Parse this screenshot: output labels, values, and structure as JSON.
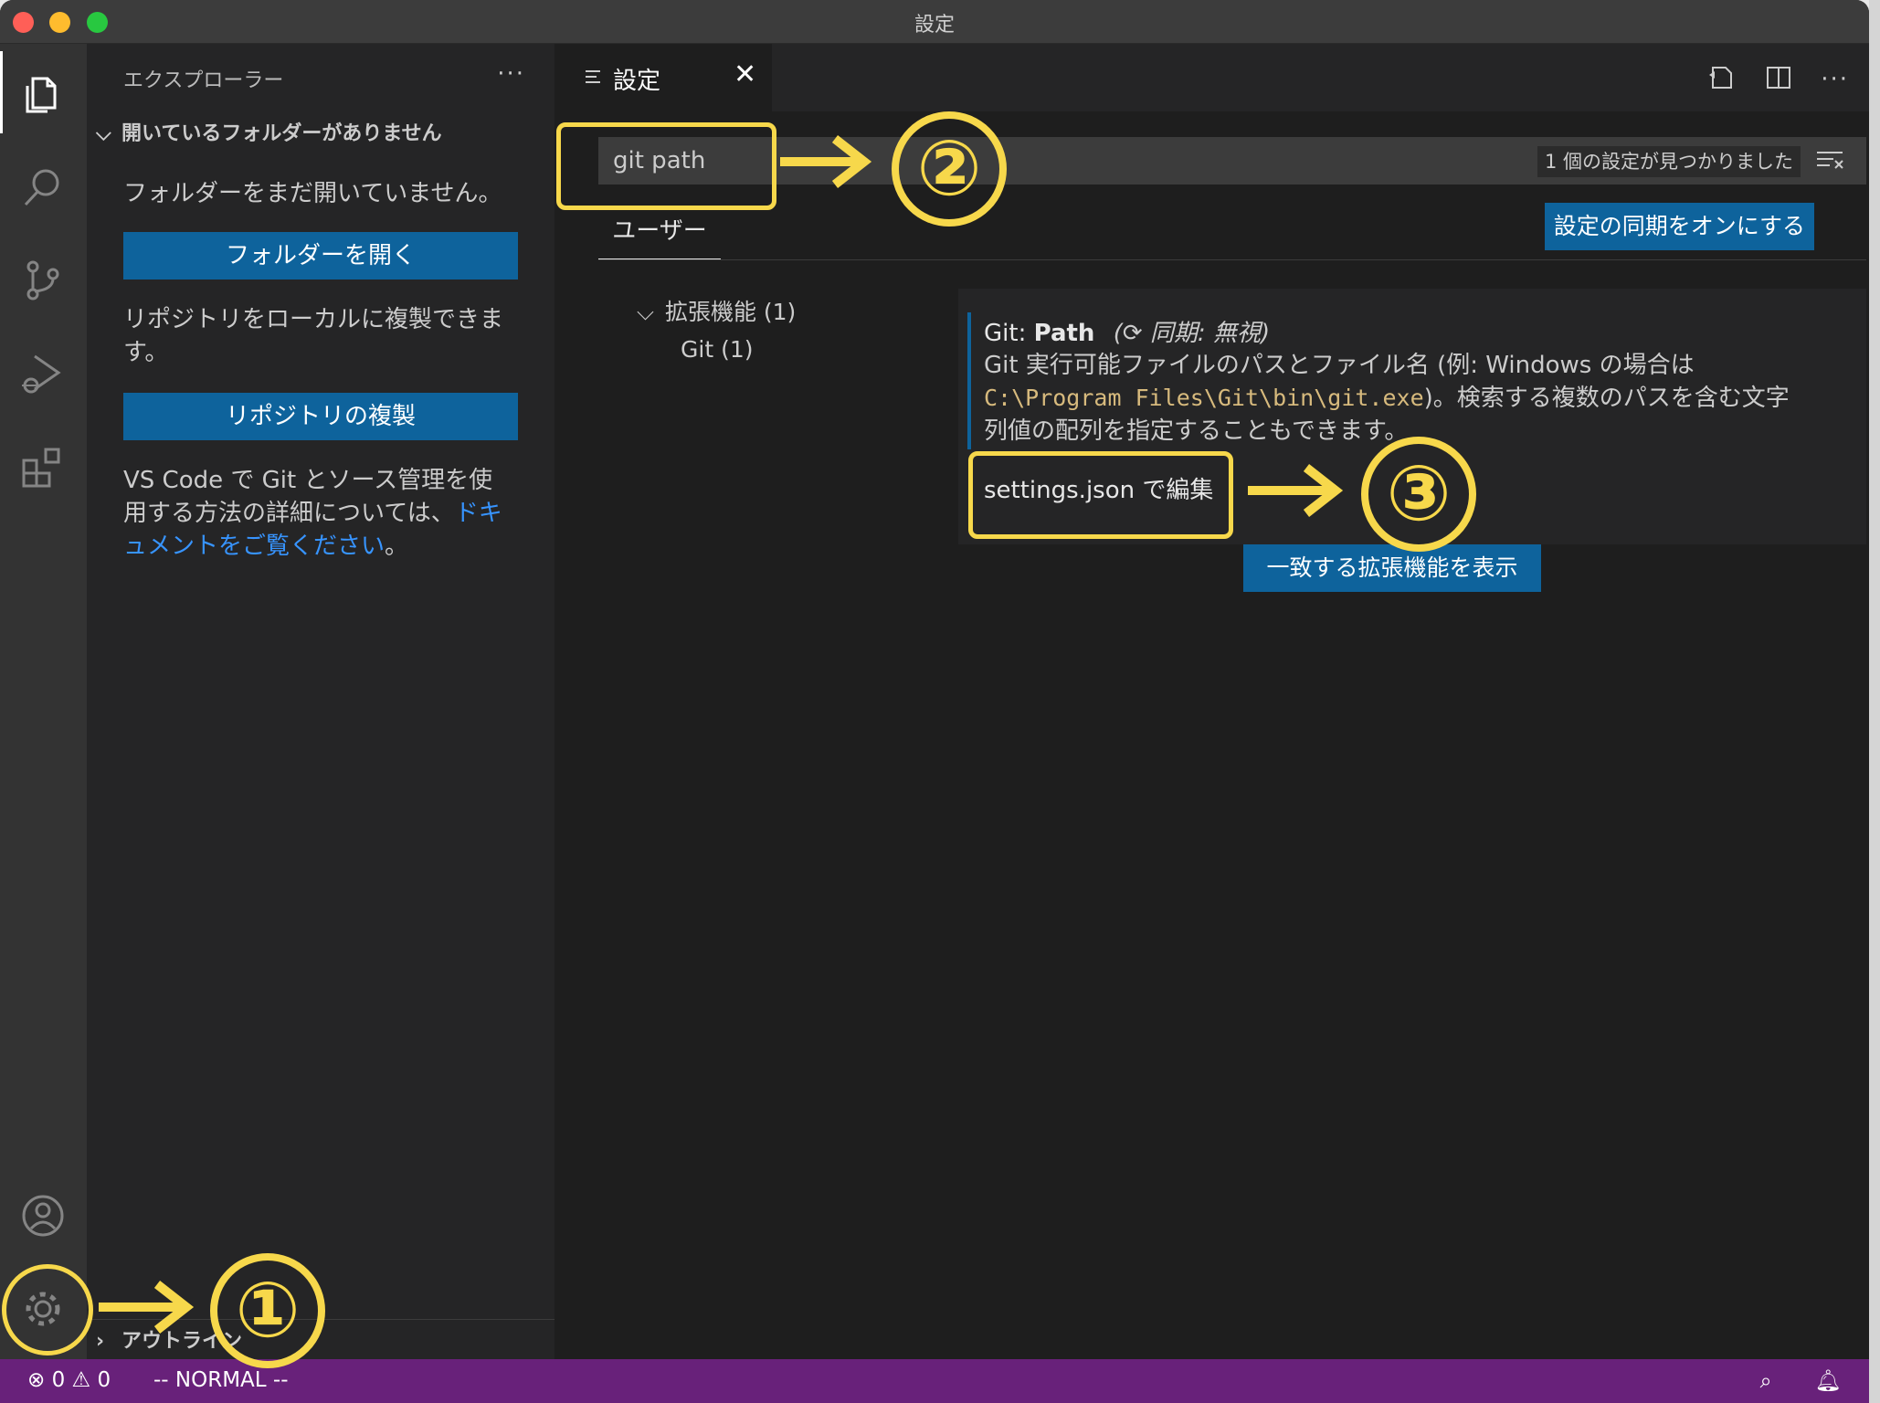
{
  "window": {
    "title": "設定",
    "traffic_lights": {
      "close": "#ff5f57",
      "minimize": "#febc2e",
      "maximize": "#28c840"
    }
  },
  "activity_bar": {
    "items": [
      {
        "icon": "files-icon"
      },
      {
        "icon": "search-icon"
      },
      {
        "icon": "source-control-icon"
      },
      {
        "icon": "run-debug-icon"
      },
      {
        "icon": "extensions-icon"
      }
    ],
    "bottom": [
      {
        "icon": "account-icon"
      },
      {
        "icon": "gear-icon"
      }
    ]
  },
  "sidebar": {
    "header": "エクスプローラー",
    "more": "···",
    "section_title": "開いているフォルダーがありません",
    "no_folder_text": "フォルダーをまだ開いていません。",
    "open_folder_button": "フォルダーを開く",
    "clone_text": "リポジトリをローカルに複製できます。",
    "clone_button": "リポジトリの複製",
    "git_text_prefix": "VS Code で Git とソース管理を使用する方法の詳細については、",
    "git_text_link": "ドキュメントをご覧ください",
    "git_text_suffix": "。",
    "outline_label": "アウトライン"
  },
  "tabs": {
    "settings_tab": {
      "label": "設定",
      "close": "✕"
    }
  },
  "settings": {
    "search_value": "git path",
    "found_count": "1 個の設定が見つかりました",
    "scope_tab": "ユーザー",
    "sync_button": "設定の同期をオンにする",
    "toc": {
      "group": "拡張機能 (1)",
      "item": "Git (1)"
    },
    "item": {
      "category": "Git: ",
      "name": "Path",
      "sync_state": "同期: 無視",
      "desc_part1": "Git 実行可能ファイルのパスとファイル名 (例: Windows の場合は ",
      "desc_code": "C:\\Program Files\\Git\\bin\\git.exe",
      "desc_part2": ")。検索する複数のパスを含む文字列値の配列を指定することもできます。",
      "edit_link": "settings.json で編集"
    },
    "extensions_button": "一致する拡張機能を表示"
  },
  "statusbar": {
    "errors": "0",
    "warnings": "0",
    "mode": "-- NORMAL --",
    "color": "#68217a"
  },
  "annotations": {
    "step1": "①",
    "step2": "②",
    "step3": "③",
    "color": "#f7d84b"
  }
}
